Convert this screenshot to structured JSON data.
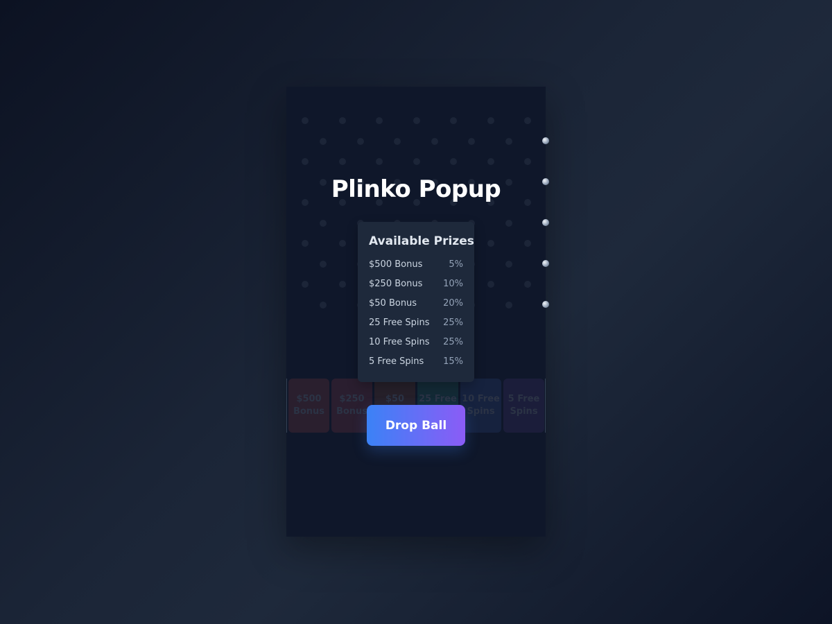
{
  "game": {
    "title": "Plinko Popup",
    "drop_button_label": "Drop Ball"
  },
  "prizes": {
    "heading": "Available Prizes",
    "items": [
      {
        "name": "$500 Bonus",
        "chance": "5%"
      },
      {
        "name": "$250 Bonus",
        "chance": "10%"
      },
      {
        "name": "$50 Bonus",
        "chance": "20%"
      },
      {
        "name": "25 Free Spins",
        "chance": "25%"
      },
      {
        "name": "10 Free Spins",
        "chance": "25%"
      },
      {
        "name": "5 Free Spins",
        "chance": "15%"
      }
    ]
  },
  "slots": [
    {
      "label": "$500 Bonus",
      "color": "#2a1f2e"
    },
    {
      "label": "$250 Bonus",
      "color": "#2a1e2f"
    },
    {
      "label": "$50 Bonus",
      "color": "#26202a"
    },
    {
      "label": "25 Free Spins",
      "color": "#132a36"
    },
    {
      "label": "10 Free Spins",
      "color": "#16223e"
    },
    {
      "label": "5 Free Spins",
      "color": "#1b1d3a"
    }
  ],
  "colors": {
    "accent_start": "#3b82f6",
    "accent_end": "#8b5cf6",
    "board": "#0f172a",
    "card": "#1e293b"
  }
}
